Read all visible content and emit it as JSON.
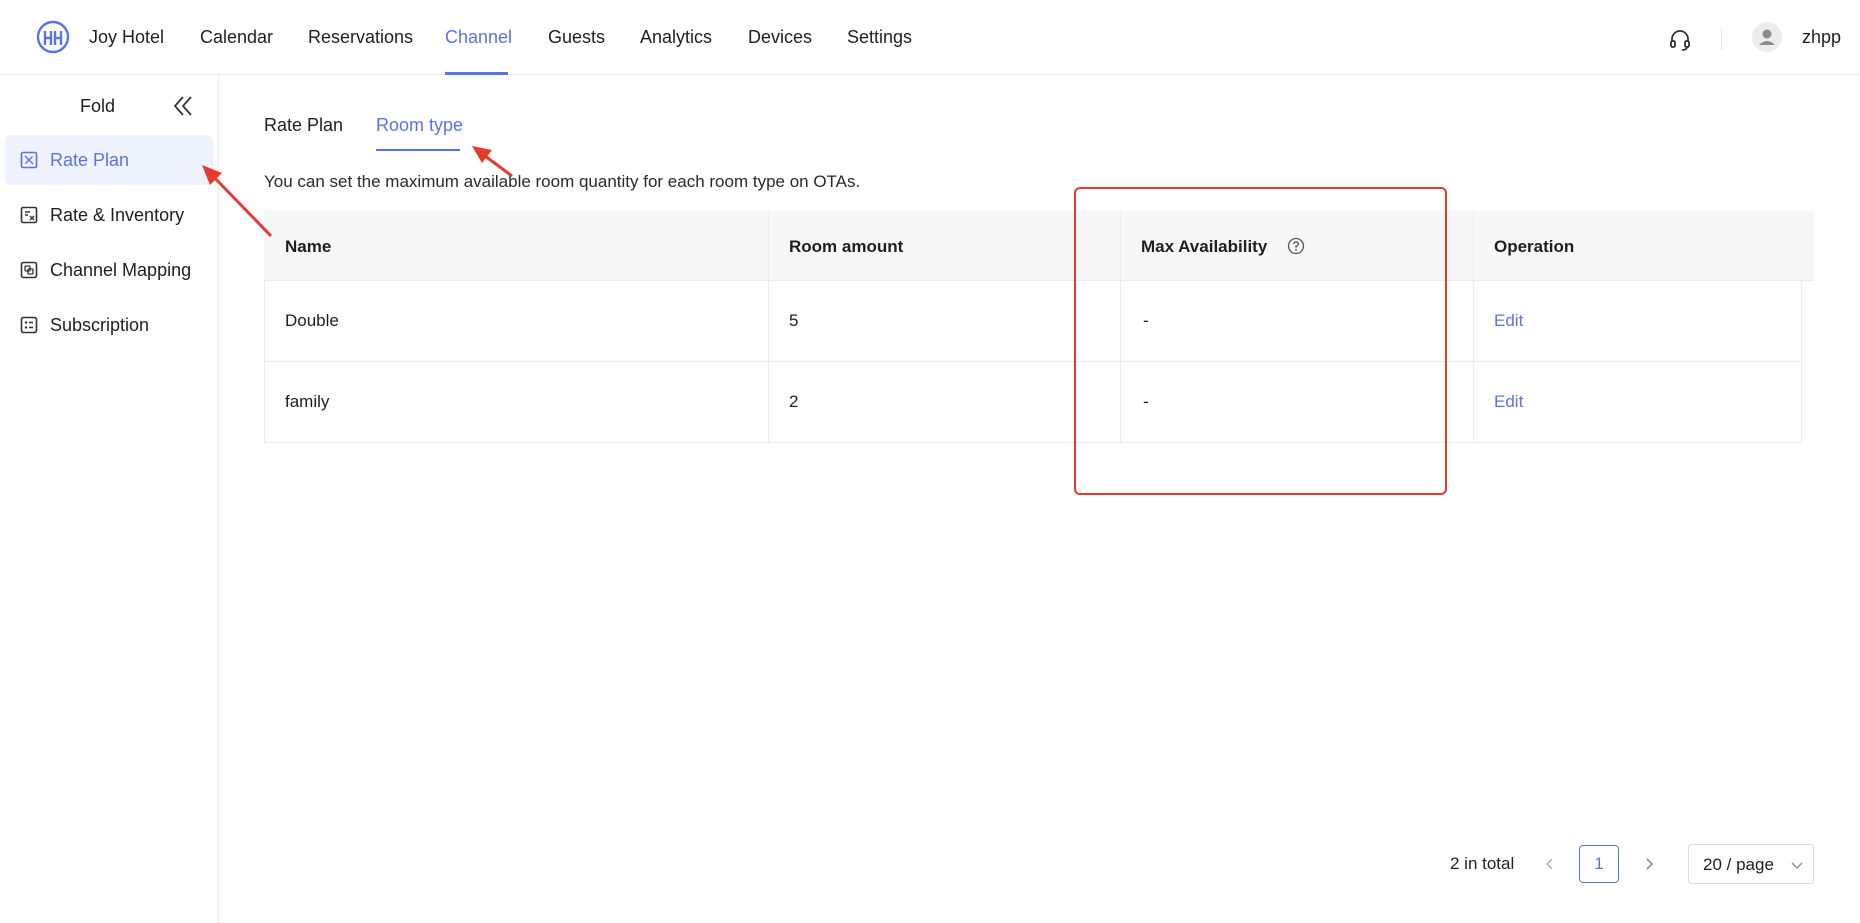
{
  "header": {
    "hotel_name": "Joy Hotel",
    "nav": [
      "Calendar",
      "Reservations",
      "Channel",
      "Guests",
      "Analytics",
      "Devices",
      "Settings"
    ],
    "active_nav": "Channel",
    "username": "zhpp"
  },
  "sidebar": {
    "fold_label": "Fold",
    "items": [
      {
        "label": "Rate Plan",
        "icon": "rate-plan-icon",
        "active": true
      },
      {
        "label": "Rate & Inventory",
        "icon": "rate-inventory-icon",
        "active": false
      },
      {
        "label": "Channel Mapping",
        "icon": "channel-mapping-icon",
        "active": false
      },
      {
        "label": "Subscription",
        "icon": "subscription-icon",
        "active": false
      }
    ]
  },
  "tabs": [
    {
      "label": "Rate Plan",
      "active": false
    },
    {
      "label": "Room type",
      "active": true
    }
  ],
  "description": "You can set the maximum available room quantity for each room type on OTAs.",
  "table": {
    "columns": [
      "Name",
      "Room amount",
      "Max Availability",
      "Operation"
    ],
    "rows": [
      {
        "name": "Double",
        "room_amount": "5",
        "max_availability": "-",
        "operation": "Edit"
      },
      {
        "name": "family",
        "room_amount": "2",
        "max_availability": "-",
        "operation": "Edit"
      }
    ]
  },
  "pagination": {
    "total_text": "2 in total",
    "current_page": "1",
    "page_size": "20 / page"
  },
  "colors": {
    "accent": "#5b73e8",
    "annotation": "#e53b2b"
  }
}
